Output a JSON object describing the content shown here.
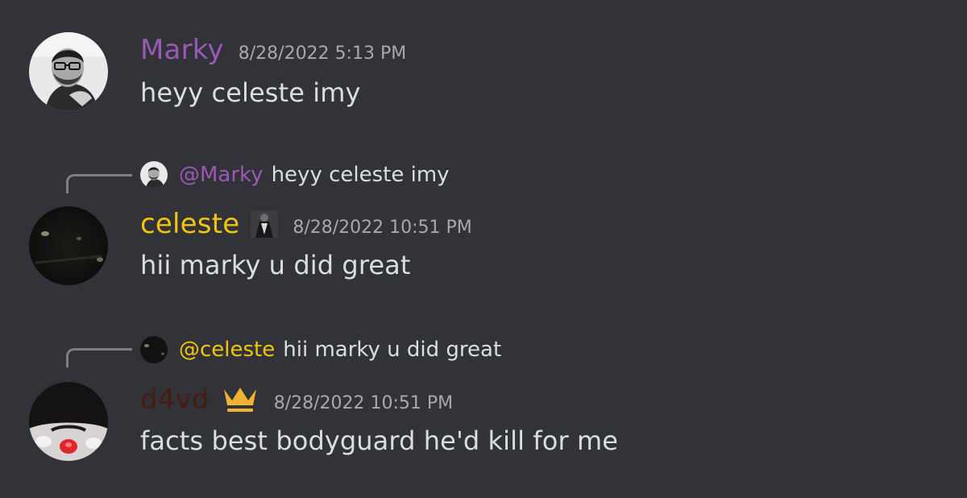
{
  "colors": {
    "background": "#313338",
    "marky_name": "#9b59b6",
    "celeste_name": "#f1c40f",
    "d4vd_name": "#4a1a12",
    "timestamp": "#a7a9ae",
    "message_text": "#dbdee1",
    "crown": "#f0b232"
  },
  "messages": [
    {
      "author": "Marky",
      "timestamp": "8/28/2022 5:13 PM",
      "content": "heyy celeste imy",
      "avatar_icon": "avatar-marky"
    },
    {
      "reply": {
        "mention": "@Marky",
        "text": "heyy celeste imy",
        "avatar_icon": "avatar-marky-small"
      },
      "author": "celeste",
      "badge_icon": "role-icon-figure",
      "timestamp": "8/28/2022 10:51 PM",
      "content": "hii marky u did great",
      "avatar_icon": "avatar-celeste"
    },
    {
      "reply": {
        "mention": "@celeste",
        "text": "hii marky u did great",
        "avatar_icon": "avatar-celeste-small"
      },
      "author": "d4vd",
      "badge_icon": "crown-icon",
      "timestamp": "8/28/2022 10:51 PM",
      "content": "facts best bodyguard he'd kill for me",
      "avatar_icon": "avatar-d4vd"
    }
  ]
}
